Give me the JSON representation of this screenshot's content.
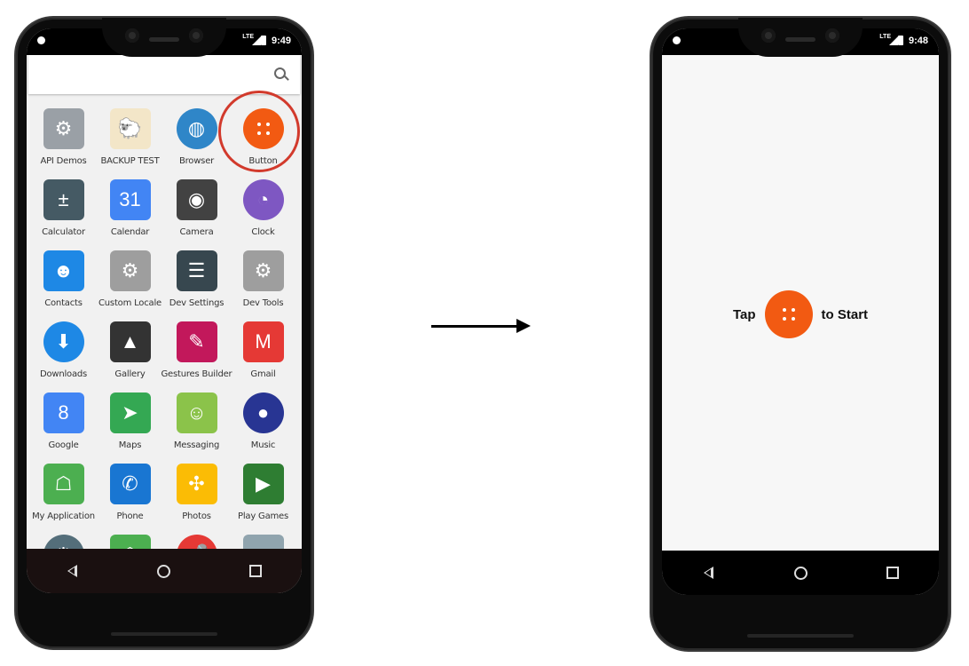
{
  "left_phone": {
    "status_time": "9:49",
    "status_network": "LTE",
    "apps": [
      {
        "label": "API Demos",
        "icon": "folder-gear-icon",
        "color": "#9aa0a6"
      },
      {
        "label": "BACKUP TEST",
        "icon": "sheep-icon",
        "color": "#f3e6c8"
      },
      {
        "label": "Browser",
        "icon": "globe-icon",
        "color": "#2f86c8"
      },
      {
        "label": "Button",
        "icon": "button-app-icon",
        "color": "#f25a12"
      },
      {
        "label": "Calculator",
        "icon": "calculator-icon",
        "color": "#455a64"
      },
      {
        "label": "Calendar",
        "icon": "calendar-icon",
        "color": "#4285f4",
        "text": "31"
      },
      {
        "label": "Camera",
        "icon": "camera-icon",
        "color": "#424242"
      },
      {
        "label": "Clock",
        "icon": "clock-icon",
        "color": "#7e57c2"
      },
      {
        "label": "Contacts",
        "icon": "contacts-icon",
        "color": "#1e88e5"
      },
      {
        "label": "Custom Locale",
        "icon": "gears-icon",
        "color": "#9e9e9e"
      },
      {
        "label": "Dev Settings",
        "icon": "sliders-icon",
        "color": "#37474f"
      },
      {
        "label": "Dev Tools",
        "icon": "gears-icon",
        "color": "#9e9e9e"
      },
      {
        "label": "Downloads",
        "icon": "download-icon",
        "color": "#1e88e5"
      },
      {
        "label": "Gallery",
        "icon": "picture-icon",
        "color": "#333333"
      },
      {
        "label": "Gestures Builder",
        "icon": "gesture-icon",
        "color": "#c2185b"
      },
      {
        "label": "Gmail",
        "icon": "gmail-icon",
        "color": "#e53935"
      },
      {
        "label": "Google",
        "icon": "google-icon",
        "color": "#4285f4",
        "text": "8"
      },
      {
        "label": "Maps",
        "icon": "maps-icon",
        "color": "#34a853"
      },
      {
        "label": "Messaging",
        "icon": "messaging-icon",
        "color": "#8bc34a"
      },
      {
        "label": "Music",
        "icon": "speaker-icon",
        "color": "#283593"
      },
      {
        "label": "My Application",
        "icon": "android-icon",
        "color": "#4caf50"
      },
      {
        "label": "Phone",
        "icon": "phone-icon",
        "color": "#1976d2"
      },
      {
        "label": "Photos",
        "icon": "pinwheel-icon",
        "color": "#fbbc05"
      },
      {
        "label": "Play Games",
        "icon": "play-games-icon",
        "color": "#2e7d32"
      },
      {
        "label": "",
        "icon": "settings-icon",
        "color": "#546e7a"
      },
      {
        "label": "",
        "icon": "android-icon",
        "color": "#4caf50"
      },
      {
        "label": "",
        "icon": "microphone-icon",
        "color": "#e53935"
      },
      {
        "label": "",
        "icon": "widget-icon",
        "color": "#90a4ae"
      }
    ]
  },
  "right_phone": {
    "status_time": "9:48",
    "status_network": "LTE",
    "prompt_before": "Tap",
    "prompt_after": "to Start",
    "button_color": "#f25a12"
  }
}
